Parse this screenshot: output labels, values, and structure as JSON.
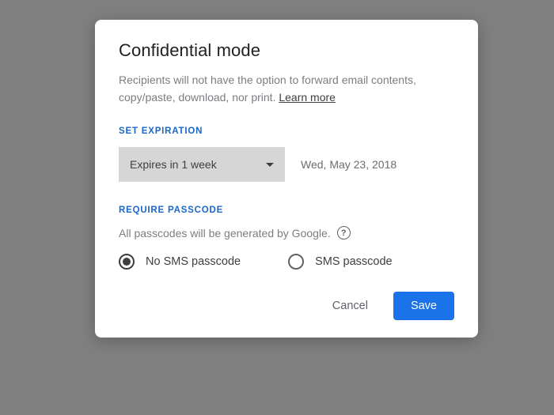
{
  "modal": {
    "title": "Confidential mode",
    "description": "Recipients will not have the option to forward email contents, copy/paste, download, nor print. ",
    "learn_more": "Learn more",
    "expiration": {
      "section_label": "SET EXPIRATION",
      "dropdown_value": "Expires in 1 week",
      "resolved_date": "Wed, May 23, 2018"
    },
    "passcode": {
      "section_label": "REQUIRE PASSCODE",
      "description": "All passcodes will be generated by Google.",
      "options": {
        "no_sms": "No SMS passcode",
        "sms": "SMS passcode"
      },
      "selected": "no_sms"
    },
    "actions": {
      "cancel": "Cancel",
      "save": "Save"
    }
  }
}
